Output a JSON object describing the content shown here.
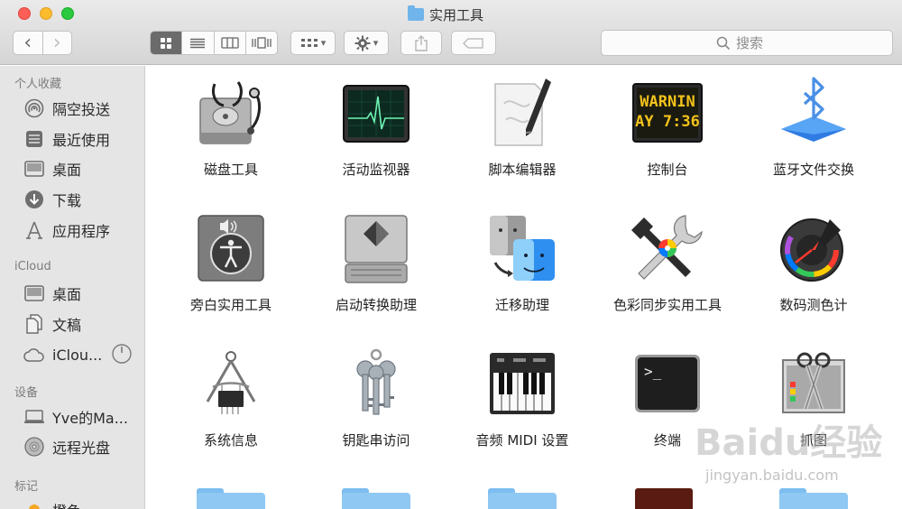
{
  "window": {
    "title": "实用工具"
  },
  "toolbar": {
    "back_glyph": "‹",
    "forward_glyph": "›",
    "arrange_glyph": "▾",
    "action_glyph": "▾"
  },
  "search": {
    "placeholder": "搜索"
  },
  "sidebar": {
    "sections": [
      {
        "header": "个人收藏",
        "items": [
          {
            "label": "隔空投送",
            "icon": "airdrop-icon"
          },
          {
            "label": "最近使用",
            "icon": "recents-icon"
          },
          {
            "label": "桌面",
            "icon": "desktop-icon"
          },
          {
            "label": "下载",
            "icon": "downloads-icon"
          },
          {
            "label": "应用程序",
            "icon": "applications-icon"
          }
        ]
      },
      {
        "header": "iCloud",
        "items": [
          {
            "label": "桌面",
            "icon": "desktop-icon"
          },
          {
            "label": "文稿",
            "icon": "documents-icon"
          },
          {
            "label": "iClou...",
            "icon": "icloud-icon"
          }
        ]
      },
      {
        "header": "设备",
        "items": [
          {
            "label": "Yve的Ma...",
            "icon": "laptop-icon"
          },
          {
            "label": "远程光盘",
            "icon": "disc-icon"
          }
        ]
      },
      {
        "header": "标记",
        "items": [
          {
            "label": "橙色",
            "icon": "tag-orange-icon"
          }
        ]
      }
    ]
  },
  "apps": [
    {
      "label": "磁盘工具",
      "icon": "disk-utility-icon"
    },
    {
      "label": "活动监视器",
      "icon": "activity-monitor-icon"
    },
    {
      "label": "脚本编辑器",
      "icon": "script-editor-icon"
    },
    {
      "label": "控制台",
      "icon": "console-icon",
      "screen_lines": [
        "WARNIN",
        "AY 7:36"
      ]
    },
    {
      "label": "蓝牙文件交换",
      "icon": "bluetooth-icon"
    },
    {
      "label": "旁白实用工具",
      "icon": "voiceover-icon"
    },
    {
      "label": "启动转换助理",
      "icon": "boot-camp-icon"
    },
    {
      "label": "迁移助理",
      "icon": "migration-assistant-icon"
    },
    {
      "label": "色彩同步实用工具",
      "icon": "colorsync-icon"
    },
    {
      "label": "数码测色计",
      "icon": "digital-color-meter-icon"
    },
    {
      "label": "系统信息",
      "icon": "system-information-icon"
    },
    {
      "label": "钥匙串访问",
      "icon": "keychain-icon"
    },
    {
      "label": "音频 MIDI 设置",
      "icon": "audio-midi-icon"
    },
    {
      "label": "终端",
      "icon": "terminal-icon",
      "prompt": ">_"
    },
    {
      "label": "抓图",
      "icon": "grab-icon"
    }
  ],
  "watermark": {
    "text": "Baidu经验",
    "sub": "jingyan.baidu.com"
  },
  "colors": {
    "accent": "#6b6b6b",
    "folder": "#8fc8f3",
    "close": "#fd5f57",
    "minimize": "#fdbb2e",
    "maximize": "#2ac93f"
  }
}
